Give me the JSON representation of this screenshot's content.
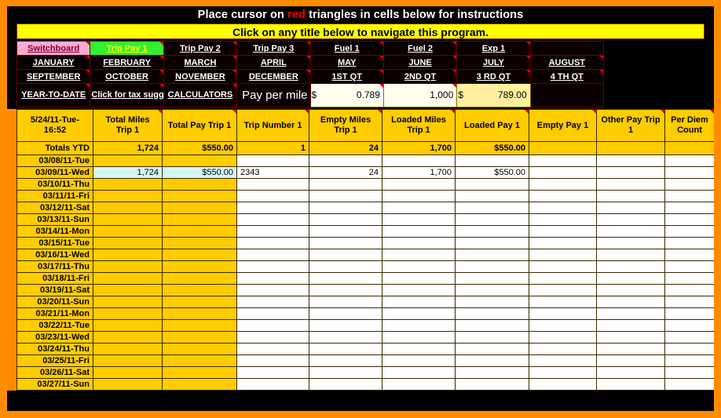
{
  "banners": {
    "instruction_pre": "Place cursor on ",
    "instruction_red": "red",
    "instruction_post": " triangles in cells below for instructions",
    "navigate": "Click on any title below to navigate this program."
  },
  "nav": {
    "row1": [
      {
        "label": "Switchboard",
        "style": "pink"
      },
      {
        "label": "Trip Pay 1",
        "style": "green"
      },
      {
        "label": "Trip Pay 2",
        "style": "dark"
      },
      {
        "label": "Trip Pay 3",
        "style": "dark"
      },
      {
        "label": "Fuel 1",
        "style": "dark"
      },
      {
        "label": "Fuel 2",
        "style": "dark"
      },
      {
        "label": "Exp 1",
        "style": "dark"
      },
      {
        "label": "",
        "style": "dark"
      }
    ],
    "row2": [
      {
        "label": "JANUARY"
      },
      {
        "label": "FEBRUARY"
      },
      {
        "label": "MARCH"
      },
      {
        "label": "APRIL"
      },
      {
        "label": "MAY"
      },
      {
        "label": "JUNE"
      },
      {
        "label": "JULY"
      },
      {
        "label": "AUGUST"
      }
    ],
    "row3": [
      {
        "label": "SEPTEMBER"
      },
      {
        "label": "OCTOBER"
      },
      {
        "label": "NOVEMBER"
      },
      {
        "label": "DECEMBER"
      },
      {
        "label": "1ST QT"
      },
      {
        "label": "2ND QT"
      },
      {
        "label": "3 RD QT"
      },
      {
        "label": "4 TH QT"
      }
    ],
    "row4": {
      "ytd": "YEAR-TO-DATE",
      "tax": "Click for tax suggestions",
      "calculators": "CALCULATORS",
      "ppm_label": "Pay per mile calculator",
      "rate_symbol": "$",
      "rate_value": "0.789",
      "miles_value": "1,000",
      "result_symbol": "$",
      "result_value": "789.00"
    }
  },
  "grid": {
    "headers": [
      "5/24/11-Tue-16:52",
      "Total Miles Trip 1",
      "Total Pay Trip 1",
      "Trip Number 1",
      "Empty Miles Trip 1",
      "Loaded Miles Trip 1",
      "Loaded Pay 1",
      "Empty Pay 1",
      "Other Pay Trip 1",
      "Per Diem Count"
    ],
    "totals": {
      "label": "Totals YTD",
      "values": [
        "1,724",
        "$550.00",
        "1",
        "24",
        "1,700",
        "$550.00",
        "",
        "",
        ""
      ]
    },
    "rows": [
      {
        "date": "03/08/11-Tue",
        "values": [
          "",
          "",
          "",
          "",
          "",
          "",
          "",
          "",
          ""
        ],
        "highlight": false
      },
      {
        "date": "03/09/11-Wed",
        "values": [
          "1,724",
          "$550.00",
          "2343",
          "24",
          "1,700",
          "$550.00",
          "",
          "",
          ""
        ],
        "highlight": true
      },
      {
        "date": "03/10/11-Thu",
        "values": [
          "",
          "",
          "",
          "",
          "",
          "",
          "",
          "",
          ""
        ],
        "highlight": false
      },
      {
        "date": "03/11/11-Fri",
        "values": [
          "",
          "",
          "",
          "",
          "",
          "",
          "",
          "",
          ""
        ],
        "highlight": false
      },
      {
        "date": "03/12/11-Sat",
        "values": [
          "",
          "",
          "",
          "",
          "",
          "",
          "",
          "",
          ""
        ],
        "highlight": false
      },
      {
        "date": "03/13/11-Sun",
        "values": [
          "",
          "",
          "",
          "",
          "",
          "",
          "",
          "",
          ""
        ],
        "highlight": false
      },
      {
        "date": "03/14/11-Mon",
        "values": [
          "",
          "",
          "",
          "",
          "",
          "",
          "",
          "",
          ""
        ],
        "highlight": false
      },
      {
        "date": "03/15/11-Tue",
        "values": [
          "",
          "",
          "",
          "",
          "",
          "",
          "",
          "",
          ""
        ],
        "highlight": false
      },
      {
        "date": "03/16/11-Wed",
        "values": [
          "",
          "",
          "",
          "",
          "",
          "",
          "",
          "",
          ""
        ],
        "highlight": false
      },
      {
        "date": "03/17/11-Thu",
        "values": [
          "",
          "",
          "",
          "",
          "",
          "",
          "",
          "",
          ""
        ],
        "highlight": false
      },
      {
        "date": "03/18/11-Fri",
        "values": [
          "",
          "",
          "",
          "",
          "",
          "",
          "",
          "",
          ""
        ],
        "highlight": false
      },
      {
        "date": "03/19/11-Sat",
        "values": [
          "",
          "",
          "",
          "",
          "",
          "",
          "",
          "",
          ""
        ],
        "highlight": false
      },
      {
        "date": "03/20/11-Sun",
        "values": [
          "",
          "",
          "",
          "",
          "",
          "",
          "",
          "",
          ""
        ],
        "highlight": false
      },
      {
        "date": "03/21/11-Mon",
        "values": [
          "",
          "",
          "",
          "",
          "",
          "",
          "",
          "",
          ""
        ],
        "highlight": false
      },
      {
        "date": "03/22/11-Tue",
        "values": [
          "",
          "",
          "",
          "",
          "",
          "",
          "",
          "",
          ""
        ],
        "highlight": false
      },
      {
        "date": "03/23/11-Wed",
        "values": [
          "",
          "",
          "",
          "",
          "",
          "",
          "",
          "",
          ""
        ],
        "highlight": false
      },
      {
        "date": "03/24/11-Thu",
        "values": [
          "",
          "",
          "",
          "",
          "",
          "",
          "",
          "",
          ""
        ],
        "highlight": false
      },
      {
        "date": "03/25/11-Fri",
        "values": [
          "",
          "",
          "",
          "",
          "",
          "",
          "",
          "",
          ""
        ],
        "highlight": false
      },
      {
        "date": "03/26/11-Sat",
        "values": [
          "",
          "",
          "",
          "",
          "",
          "",
          "",
          "",
          ""
        ],
        "highlight": false
      },
      {
        "date": "03/27/11-Sun",
        "values": [
          "",
          "",
          "",
          "",
          "",
          "",
          "",
          "",
          ""
        ],
        "highlight": false
      }
    ]
  },
  "colors": {
    "frame_orange": "#FF8C00",
    "header_yellow": "#FFCC00",
    "banner_yellow": "#FFFF00",
    "switchboard_pink": "#FFA8D0",
    "active_green": "#33EE33",
    "comment_red": "#E00000"
  }
}
